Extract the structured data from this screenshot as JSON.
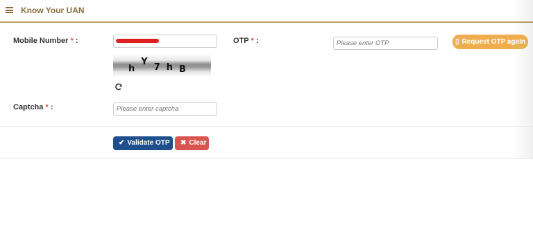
{
  "header": {
    "title": "Know Your UAN",
    "menu_icon": "hamburger-menu-icon"
  },
  "form": {
    "mobile": {
      "label": "Mobile Number",
      "required_mark": "*",
      "colon": ":",
      "value_masked": true
    },
    "otp": {
      "label": "OTP",
      "required_mark": "*",
      "colon": ":",
      "placeholder": "Please enter OTP"
    },
    "captcha_image": {
      "text": "hY7hB",
      "refresh_icon": "refresh-icon"
    },
    "captcha": {
      "label": "Captcha",
      "required_mark": "*",
      "colon": ":",
      "placeholder": "Please enter captcha"
    }
  },
  "buttons": {
    "request_otp": {
      "label": "Request OTP again",
      "icon": "mobile-icon",
      "color": "#f0ad4e"
    },
    "validate": {
      "label": "Validate OTP",
      "icon": "check-icon",
      "color": "#1f4f8c"
    },
    "clear": {
      "label": "Clear",
      "icon": "times-icon",
      "color": "#d9534f"
    }
  },
  "colors": {
    "header_text": "#8a6d3b",
    "header_border": "#b9a06f",
    "required": "#d9534f"
  }
}
